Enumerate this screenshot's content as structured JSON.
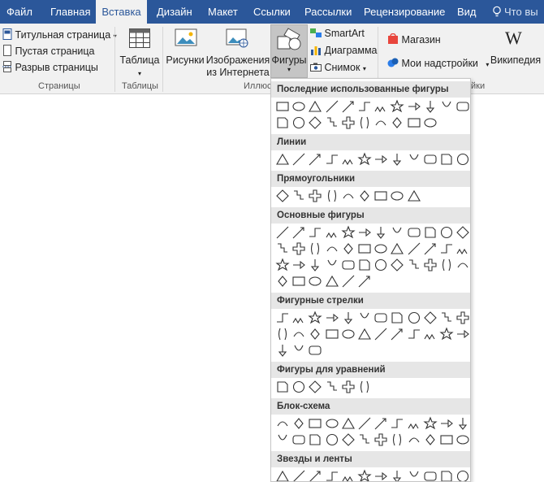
{
  "tabs": [
    "Файл",
    "Главная",
    "Вставка",
    "Дизайн",
    "Макет",
    "Ссылки",
    "Рассылки",
    "Рецензирование",
    "Вид"
  ],
  "active_tab": "Вставка",
  "tell_me": "Что вы",
  "ribbon": {
    "pages": {
      "cover": "Титульная страница",
      "blank": "Пустая страница",
      "break": "Разрыв страницы",
      "label": "Страницы"
    },
    "tables": {
      "table": "Таблица",
      "label": "Таблицы"
    },
    "illustrations": {
      "pictures": "Рисунки",
      "online_line1": "Изображения",
      "online_line2": "из Интернета",
      "shapes": "Фигуры",
      "smartart": "SmartArt",
      "chart": "Диаграмма",
      "screenshot": "Снимок",
      "label": "Иллюс"
    },
    "addins": {
      "store": "Магазин",
      "my_addins": "Мои надстройки",
      "wikipedia": "Википедия",
      "label": "йки"
    }
  },
  "gallery": {
    "sections": [
      "Последние использованные фигуры",
      "Линии",
      "Прямоугольники",
      "Основные фигуры",
      "Фигурные стрелки",
      "Фигуры для уравнений",
      "Блок-схема",
      "Звезды и ленты"
    ],
    "counts": [
      22,
      12,
      9,
      42,
      27,
      6,
      24,
      12
    ]
  },
  "colors": {
    "tab_bar": "#2b579a",
    "ribbon": "#f1f1f1",
    "gallery_header": "#e6e6e6",
    "selected": "#c5c5c5"
  }
}
